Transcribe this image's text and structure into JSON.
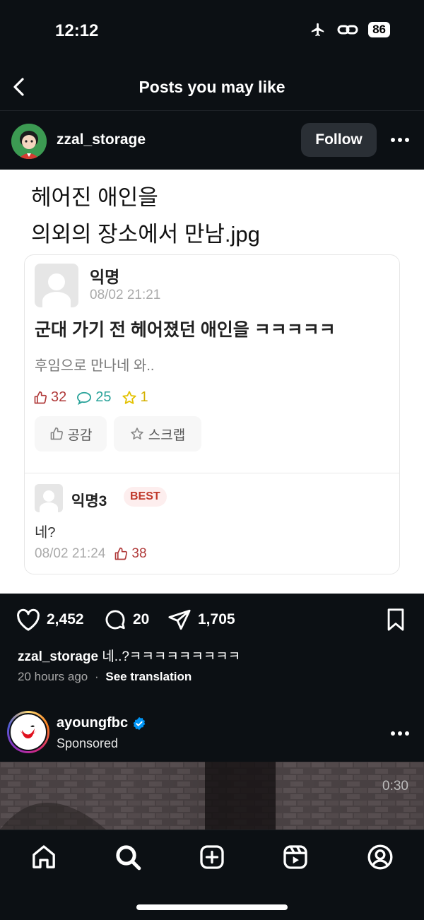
{
  "status": {
    "time": "12:12",
    "battery": "86"
  },
  "nav": {
    "title": "Posts you may like"
  },
  "post": {
    "username": "zzal_storage",
    "follow_label": "Follow",
    "image": {
      "title_line1": "헤어진 애인을",
      "title_line2": "의외의 장소에서 만남.jpg",
      "card": {
        "author": "익명",
        "date": "08/02 21:21",
        "headline": "군대 가기 전 헤어졌던 애인을 ㅋㅋㅋㅋㅋ",
        "body": "후임으로 만나네 와..",
        "likes": "32",
        "comments": "25",
        "scraps": "1",
        "like_btn": "공감",
        "scrap_btn": "스크랩",
        "reply": {
          "author": "익명3",
          "badge": "BEST",
          "text": "네?",
          "date": "08/02 21:24",
          "likes": "38"
        }
      }
    },
    "likes": "2,452",
    "comments": "20",
    "shares": "1,705",
    "caption_user": "zzal_storage",
    "caption_text": " 네..?ㅋㅋㅋㅋㅋㅋㅋㅋㅋ",
    "time": "20 hours ago",
    "separator": "·",
    "see_translation": "See translation"
  },
  "ad": {
    "username": "ayoungfbc",
    "sponsored": "Sponsored",
    "video_time": "0:30"
  },
  "tabs": [
    "home-icon",
    "search-icon",
    "create-icon",
    "reels-icon",
    "profile-icon"
  ],
  "colors": {
    "background": "#0c1014",
    "verified": "#0095f6",
    "like_red": "#b03a3a",
    "comment_teal": "#2aa39a",
    "star_yellow": "#e3c100"
  }
}
